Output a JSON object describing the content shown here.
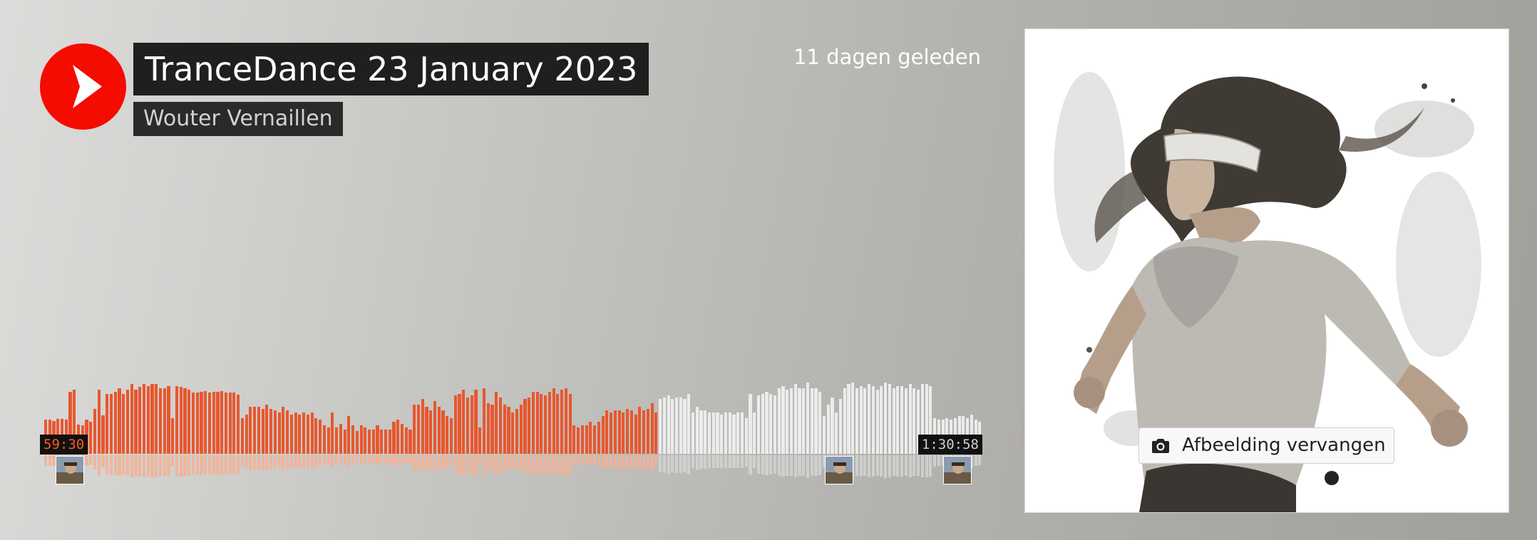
{
  "track": {
    "title": "TranceDance 23 January 2023",
    "artist": "Wouter Vernaillen",
    "posted": "11 dagen geleden"
  },
  "player": {
    "current_time": "59:30",
    "total_duration": "1:30:58",
    "progress_fraction": 0.654
  },
  "artwork": {
    "replace_label": "Afbeelding vervangen"
  },
  "icons": {
    "play": "play-icon",
    "camera": "camera-icon"
  },
  "colors": {
    "accent": "#f50c00",
    "played_wave": "#e8572f",
    "played_reflection": "#f3b295",
    "unplayed_wave": "#ececec",
    "unplayed_reflection": "#d4d4d4"
  },
  "waveform": {
    "levels": [
      0.36,
      0.36,
      0.35,
      0.37,
      0.37,
      0.36,
      0.66,
      0.68,
      0.31,
      0.3,
      0.36,
      0.34,
      0.48,
      0.68,
      0.41,
      0.64,
      0.64,
      0.66,
      0.7,
      0.64,
      0.68,
      0.74,
      0.68,
      0.71,
      0.74,
      0.72,
      0.74,
      0.74,
      0.7,
      0.7,
      0.72,
      0.38,
      0.72,
      0.71,
      0.7,
      0.68,
      0.65,
      0.65,
      0.66,
      0.67,
      0.65,
      0.66,
      0.66,
      0.67,
      0.65,
      0.65,
      0.65,
      0.63,
      0.38,
      0.42,
      0.5,
      0.5,
      0.5,
      0.48,
      0.52,
      0.48,
      0.46,
      0.44,
      0.5,
      0.46,
      0.42,
      0.44,
      0.42,
      0.44,
      0.42,
      0.44,
      0.38,
      0.36,
      0.3,
      0.28,
      0.44,
      0.28,
      0.32,
      0.26,
      0.4,
      0.3,
      0.24,
      0.3,
      0.28,
      0.26,
      0.26,
      0.3,
      0.26,
      0.26,
      0.26,
      0.34,
      0.36,
      0.32,
      0.28,
      0.26,
      0.52,
      0.52,
      0.58,
      0.5,
      0.46,
      0.56,
      0.5,
      0.46,
      0.4,
      0.38,
      0.62,
      0.64,
      0.68,
      0.6,
      0.62,
      0.68,
      0.28,
      0.7,
      0.54,
      0.52,
      0.66,
      0.6,
      0.52,
      0.5,
      0.44,
      0.48,
      0.52,
      0.58,
      0.6,
      0.66,
      0.66,
      0.64,
      0.62,
      0.66,
      0.7,
      0.64,
      0.68,
      0.7,
      0.64,
      0.3,
      0.28,
      0.3,
      0.3,
      0.34,
      0.3,
      0.34,
      0.4,
      0.46,
      0.44,
      0.46,
      0.46,
      0.44,
      0.48,
      0.46,
      0.42,
      0.5,
      0.46,
      0.48,
      0.54,
      0.44,
      0.58,
      0.6,
      0.62,
      0.58,
      0.6,
      0.6,
      0.58,
      0.64,
      0.44,
      0.5,
      0.46,
      0.46,
      0.44,
      0.44,
      0.44,
      0.42,
      0.44,
      0.44,
      0.42,
      0.44,
      0.44,
      0.38,
      0.64,
      0.44,
      0.62,
      0.64,
      0.66,
      0.64,
      0.62,
      0.7,
      0.72,
      0.68,
      0.7,
      0.74,
      0.7,
      0.7,
      0.76,
      0.7,
      0.7,
      0.66,
      0.4,
      0.52,
      0.6,
      0.44,
      0.58,
      0.7,
      0.74,
      0.76,
      0.7,
      0.72,
      0.7,
      0.74,
      0.72,
      0.68,
      0.72,
      0.76,
      0.74,
      0.7,
      0.72,
      0.72,
      0.7,
      0.74,
      0.7,
      0.68,
      0.74,
      0.74,
      0.72,
      0.38,
      0.36,
      0.36,
      0.38,
      0.36,
      0.38,
      0.4,
      0.4,
      0.38,
      0.42,
      0.36,
      0.34
    ],
    "comments": [
      0.012,
      0.832,
      0.958
    ]
  }
}
